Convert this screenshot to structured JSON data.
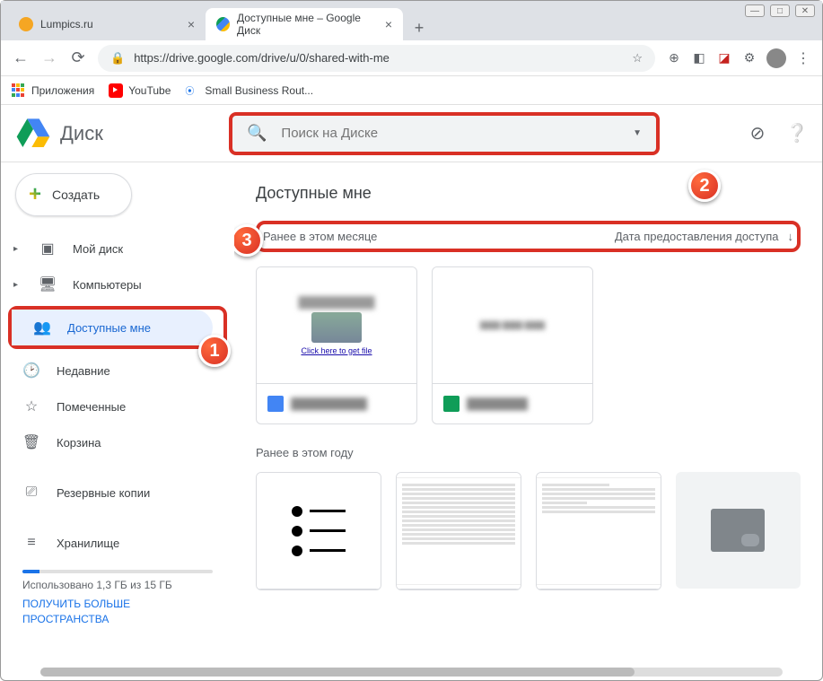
{
  "window": {
    "minimize": "—",
    "maximize": "□",
    "close": "✕"
  },
  "tabs": [
    {
      "title": "Lumpics.ru",
      "favColor": "#f5a623"
    },
    {
      "title": "Доступные мне – Google Диск",
      "favColor": "#0f9d58"
    }
  ],
  "tab_add": "+",
  "addr": {
    "back": "←",
    "fwd": "→",
    "reload": "⟳",
    "url": "https://drive.google.com/drive/u/0/shared-with-me",
    "star": "☆"
  },
  "bookmarks": [
    {
      "label": "Приложения",
      "iconColor": "#5f6368"
    },
    {
      "label": "YouTube",
      "iconColor": "#ff0000"
    },
    {
      "label": "Small Business Rout...",
      "iconColor": "#1a73e8"
    }
  ],
  "drive": {
    "product": "Диск",
    "search_placeholder": "Поиск на Диске",
    "create": "Создать",
    "nav": {
      "mydrive": "Мой диск",
      "computers": "Компьютеры",
      "shared": "Доступные мне",
      "recent": "Недавние",
      "starred": "Помеченные",
      "trash": "Корзина",
      "backups": "Резервные копии",
      "storage": "Хранилище"
    },
    "storage_used": "Использовано 1,3 ГБ из 15 ГБ",
    "storage_link": "ПОЛУЧИТЬ БОЛЬШЕ ПРОСТРАНСТВА"
  },
  "main": {
    "title": "Доступные мне",
    "section1": "Ранее в этом месяце",
    "sort_label": "Дата предоставления доступа",
    "section2": "Ранее в этом году",
    "file1_link": "Click here to get file"
  },
  "callouts": {
    "one": "1",
    "two": "2",
    "three": "3"
  }
}
